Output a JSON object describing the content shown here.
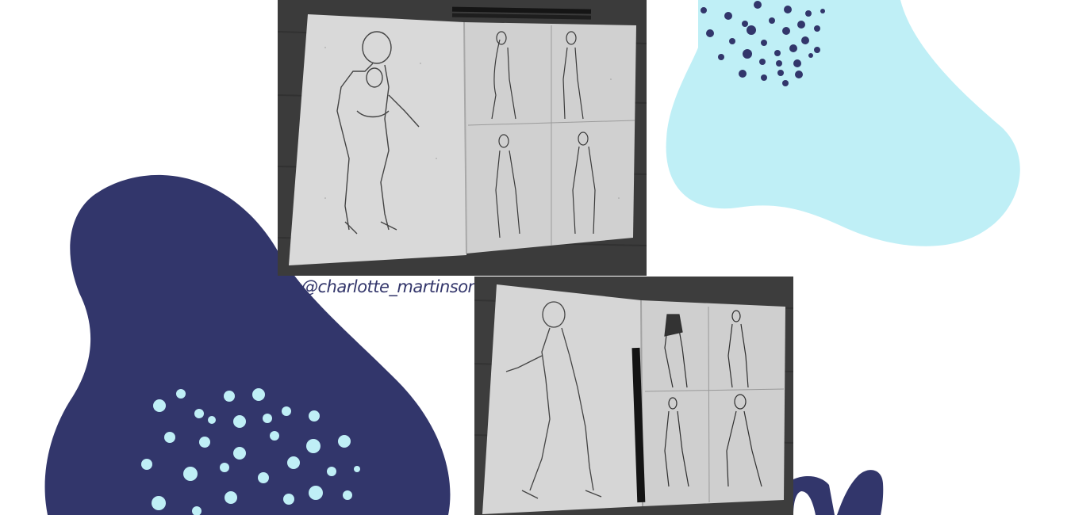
{
  "social": {
    "handle": "@charlotte_martinson"
  },
  "palette": {
    "navy": "#32366b",
    "light_blue": "#bfeff6",
    "background": "#ffffff"
  },
  "images": [
    {
      "name": "sketchbook-photo-top",
      "description_icon": "sketchbook-figure-drawings"
    },
    {
      "name": "sketchbook-photo-bottom",
      "description_icon": "sketchbook-figure-drawings-with-pen"
    }
  ]
}
